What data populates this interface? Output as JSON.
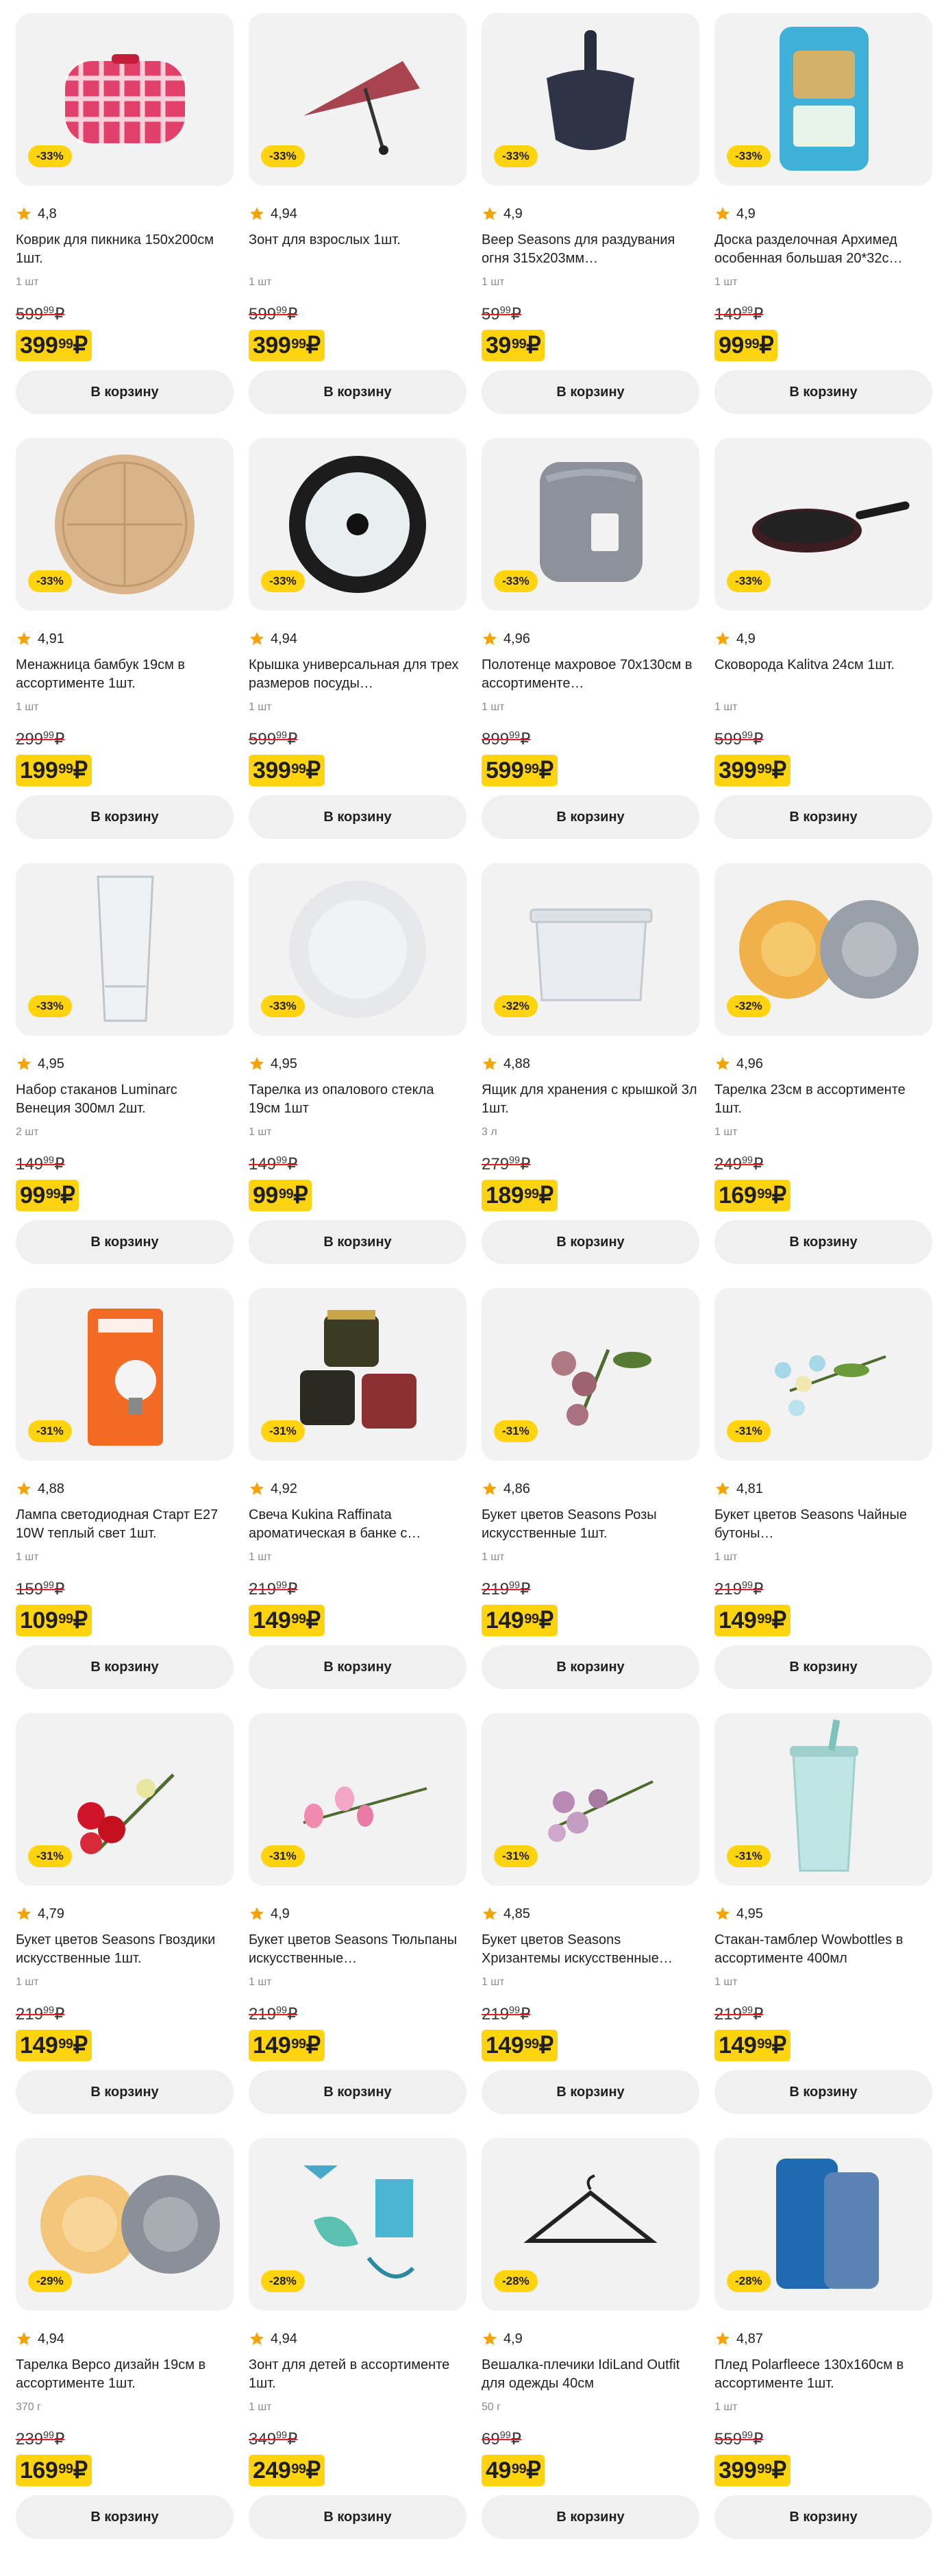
{
  "colors": {
    "accent": "#ffd30d",
    "button_bg": "#f0f0f0",
    "card_bg": "#f2f2f2",
    "star": "#f5a300",
    "strike": "#e02020"
  },
  "products": [
    {
      "badge": "-33%",
      "rating": "4,8",
      "title": "Коврик для пикника 150х200см 1шт.",
      "unit": "1 шт",
      "old_main": "599",
      "old_kop": "99",
      "new_main": "399",
      "new_kop": "99",
      "cart": "В корзину",
      "icon": "picnic-blanket-icon"
    },
    {
      "badge": "-33%",
      "rating": "4,94",
      "title": "Зонт для взрослых 1шт.",
      "unit": "1 шт",
      "old_main": "599",
      "old_kop": "99",
      "new_main": "399",
      "new_kop": "99",
      "cart": "В корзину",
      "icon": "umbrella-icon"
    },
    {
      "badge": "-33%",
      "rating": "4,9",
      "title": "Веер Seasons для раздувания огня 315х203мм…",
      "unit": "1 шт",
      "old_main": "59",
      "old_kop": "99",
      "new_main": "39",
      "new_kop": "99",
      "cart": "В корзину",
      "icon": "fan-icon"
    },
    {
      "badge": "-33%",
      "rating": "4,9",
      "title": "Доска разделочная Архимед особенная большая 20*32с…",
      "unit": "1 шт",
      "old_main": "149",
      "old_kop": "99",
      "new_main": "99",
      "new_kop": "99",
      "cart": "В корзину",
      "icon": "cutting-board-icon"
    },
    {
      "badge": "-33%",
      "rating": "4,91",
      "title": "Менажница бамбук 19см в ассортименте 1шт.",
      "unit": "1 шт",
      "old_main": "299",
      "old_kop": "99",
      "new_main": "199",
      "new_kop": "99",
      "cart": "В корзину",
      "icon": "bamboo-plate-icon"
    },
    {
      "badge": "-33%",
      "rating": "4,94",
      "title": "Крышка универсальная для трех размеров посуды…",
      "unit": "1 шт",
      "old_main": "599",
      "old_kop": "99",
      "new_main": "399",
      "new_kop": "99",
      "cart": "В корзину",
      "icon": "lid-icon"
    },
    {
      "badge": "-33%",
      "rating": "4,96",
      "title": "Полотенце махровое 70х130см в ассортименте…",
      "unit": "1 шт",
      "old_main": "899",
      "old_kop": "99",
      "new_main": "599",
      "new_kop": "99",
      "cart": "В корзину",
      "icon": "towel-icon"
    },
    {
      "badge": "-33%",
      "rating": "4,9",
      "title": "Сковорода Kalitva 24см 1шт.",
      "unit": "1 шт",
      "old_main": "599",
      "old_kop": "99",
      "new_main": "399",
      "new_kop": "99",
      "cart": "В корзину",
      "icon": "frying-pan-icon"
    },
    {
      "badge": "-33%",
      "rating": "4,95",
      "title": "Набор стаканов Luminarc Венеция 300мл 2шт.",
      "unit": "2 шт",
      "old_main": "149",
      "old_kop": "99",
      "new_main": "99",
      "new_kop": "99",
      "cart": "В корзину",
      "icon": "glass-icon"
    },
    {
      "badge": "-33%",
      "rating": "4,95",
      "title": "Тарелка из опалового стекла 19см 1шт",
      "unit": "1 шт",
      "old_main": "149",
      "old_kop": "99",
      "new_main": "99",
      "new_kop": "99",
      "cart": "В корзину",
      "icon": "white-plate-icon"
    },
    {
      "badge": "-32%",
      "rating": "4,88",
      "title": "Ящик для хранения с крышкой 3л 1шт.",
      "unit": "3 л",
      "old_main": "279",
      "old_kop": "99",
      "new_main": "189",
      "new_kop": "99",
      "cart": "В корзину",
      "icon": "storage-box-icon"
    },
    {
      "badge": "-32%",
      "rating": "4,96",
      "title": "Тарелка 23см в ассортименте 1шт.",
      "unit": "1 шт",
      "old_main": "249",
      "old_kop": "99",
      "new_main": "169",
      "new_kop": "99",
      "cart": "В корзину",
      "icon": "glass-plates-icon"
    },
    {
      "badge": "-31%",
      "rating": "4,88",
      "title": "Лампа светодиодная Старт E27 10W теплый свет 1шт.",
      "unit": "1 шт",
      "old_main": "159",
      "old_kop": "99",
      "new_main": "109",
      "new_kop": "99",
      "cart": "В корзину",
      "icon": "led-bulb-box-icon"
    },
    {
      "badge": "-31%",
      "rating": "4,92",
      "title": "Свеча Kukina Raffinata ароматическая в банке с…",
      "unit": "1 шт",
      "old_main": "219",
      "old_kop": "99",
      "new_main": "149",
      "new_kop": "99",
      "cart": "В корзину",
      "icon": "candle-jars-icon"
    },
    {
      "badge": "-31%",
      "rating": "4,86",
      "title": "Букет цветов Seasons Розы искусственные 1шт.",
      "unit": "1 шт",
      "old_main": "219",
      "old_kop": "99",
      "new_main": "149",
      "new_kop": "99",
      "cart": "В корзину",
      "icon": "roses-bouquet-icon"
    },
    {
      "badge": "-31%",
      "rating": "4,81",
      "title": "Букет цветов Seasons Чайные бутоны…",
      "unit": "1 шт",
      "old_main": "219",
      "old_kop": "99",
      "new_main": "149",
      "new_kop": "99",
      "cart": "В корзину",
      "icon": "tea-buds-bouquet-icon"
    },
    {
      "badge": "-31%",
      "rating": "4,79",
      "title": "Букет цветов Seasons Гвоздики искусственные 1шт.",
      "unit": "1 шт",
      "old_main": "219",
      "old_kop": "99",
      "new_main": "149",
      "new_kop": "99",
      "cart": "В корзину",
      "icon": "carnations-bouquet-icon"
    },
    {
      "badge": "-31%",
      "rating": "4,9",
      "title": "Букет цветов Seasons Тюльпаны искусственные…",
      "unit": "1 шт",
      "old_main": "219",
      "old_kop": "99",
      "new_main": "149",
      "new_kop": "99",
      "cart": "В корзину",
      "icon": "tulips-bouquet-icon"
    },
    {
      "badge": "-31%",
      "rating": "4,85",
      "title": "Букет цветов Seasons Хризантемы искусственные…",
      "unit": "1 шт",
      "old_main": "219",
      "old_kop": "99",
      "new_main": "149",
      "new_kop": "99",
      "cart": "В корзину",
      "icon": "chrysanthemums-bouquet-icon"
    },
    {
      "badge": "-31%",
      "rating": "4,95",
      "title": "Стакан-тамблер Wowbottles в ассортименте 400мл",
      "unit": "1 шт",
      "old_main": "219",
      "old_kop": "99",
      "new_main": "149",
      "new_kop": "99",
      "cart": "В корзину",
      "icon": "tumbler-icon"
    },
    {
      "badge": "-29%",
      "rating": "4,94",
      "title": "Тарелка Версо дизайн 19см в ассортименте 1шт.",
      "unit": "370 г",
      "old_main": "239",
      "old_kop": "99",
      "new_main": "169",
      "new_kop": "99",
      "cart": "В корзину",
      "icon": "verso-plates-icon"
    },
    {
      "badge": "-28%",
      "rating": "4,94",
      "title": "Зонт для детей в ассортименте 1шт.",
      "unit": "1 шт",
      "old_main": "349",
      "old_kop": "99",
      "new_main": "249",
      "new_kop": "99",
      "cart": "В корзину",
      "icon": "kids-umbrella-icon"
    },
    {
      "badge": "-28%",
      "rating": "4,9",
      "title": "Вешалка-плечики IdiLand Outfit для одежды 40см",
      "unit": "50 г",
      "old_main": "69",
      "old_kop": "99",
      "new_main": "49",
      "new_kop": "99",
      "cart": "В корзину",
      "icon": "hanger-icon"
    },
    {
      "badge": "-28%",
      "rating": "4,87",
      "title": "Плед Polarfleece 130х160см в ассортименте 1шт.",
      "unit": "1 шт",
      "old_main": "559",
      "old_kop": "99",
      "new_main": "399",
      "new_kop": "99",
      "cart": "В корзину",
      "icon": "fleece-blanket-icon"
    }
  ]
}
